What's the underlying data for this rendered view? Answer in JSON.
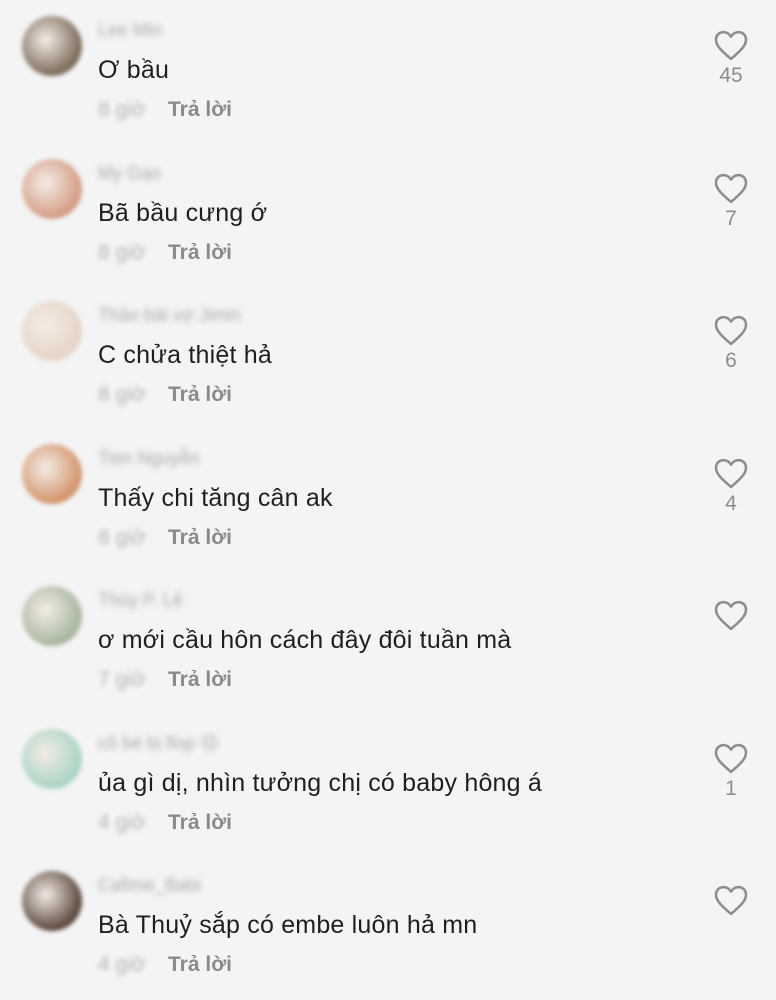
{
  "comments": [
    {
      "username": "Lee Min",
      "text": "Ơ bầu",
      "time": "8 giờ",
      "reply": "Trả lời",
      "likes": "45",
      "avatar_color": "#7a6a58"
    },
    {
      "username": "My Gạo",
      "text": "Bã bầu cưng ớ",
      "time": "8 giờ",
      "reply": "Trả lời",
      "likes": "7",
      "avatar_color": "#d49b83"
    },
    {
      "username": "Thảo bài vợ Jimin",
      "text": "C chửa thiệt hả",
      "time": "8 giờ",
      "reply": "Trả lời",
      "likes": "6",
      "avatar_color": "#e6d4c6"
    },
    {
      "username": "Tien Nguyễn",
      "text": "Thấy chi tăng cân ak",
      "time": "8 giờ",
      "reply": "Trả lời",
      "likes": "4",
      "avatar_color": "#d3936a"
    },
    {
      "username": "Thùy P. Lê",
      "text": "ơ mới cầu hôn cách đây đôi tuần mà",
      "time": "7 giờ",
      "reply": "Trả lời",
      "likes": "",
      "avatar_color": "#a7b59f"
    },
    {
      "username": "cô bé bị flop 😔",
      "text": "ủa gì dị, nhìn tưởng chị có baby hông á",
      "time": "4 giờ",
      "reply": "Trả lời",
      "likes": "1",
      "avatar_color": "#a9d3c3"
    },
    {
      "username": "Cafime_Babi",
      "text": "Bà Thuỷ sắp có embe luôn hả mn",
      "time": "4 giờ",
      "reply": "Trả lời",
      "likes": "",
      "avatar_color": "#5a463c"
    }
  ]
}
